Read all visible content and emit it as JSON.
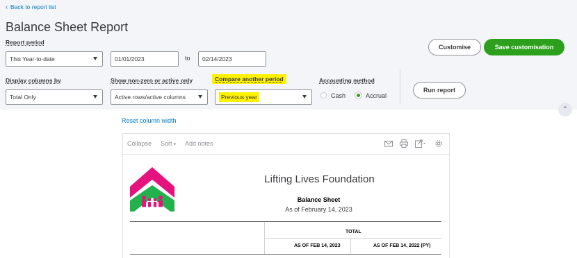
{
  "nav": {
    "back_label": "Back to report list"
  },
  "page": {
    "title": "Balance Sheet Report"
  },
  "filters": {
    "report_period_label": "Report period",
    "report_period_value": "This Year-to-date",
    "date_from": "01/01/2023",
    "to_label": "to",
    "date_to": "02/14/2023",
    "display_columns_label": "Display columns by",
    "display_columns_value": "Total Only",
    "show_nonzero_label": "Show non-zero or active only",
    "show_nonzero_value": "Active rows/active columns",
    "compare_label": "Compare another period",
    "compare_value": "Previous year",
    "accounting_method_label": "Accounting method",
    "method_cash": "Cash",
    "method_accrual": "Accrual",
    "selected_method": "Accrual"
  },
  "actions": {
    "customise": "Customise",
    "save_customisation": "Save customisation",
    "run_report": "Run report"
  },
  "report": {
    "reset_column_width": "Reset column width",
    "toolbar": {
      "collapse": "Collapse",
      "sort": "Sort",
      "add_notes": "Add notes"
    },
    "icons": [
      "mail-icon",
      "print-icon",
      "export-icon",
      "settings-icon"
    ],
    "company": "Lifting Lives Foundation",
    "name": "Balance Sheet",
    "as_of": "As of February 14, 2023",
    "total_header": "TOTAL",
    "columns": [
      "AS OF FEB 14, 2023",
      "AS OF FEB 14, 2022 (PY)"
    ]
  },
  "colors": {
    "accent_green": "#2ca01c",
    "link_blue": "#0077c5",
    "highlight_yellow": "#fff200",
    "logo_magenta": "#e6127d",
    "logo_green": "#22b24c"
  }
}
